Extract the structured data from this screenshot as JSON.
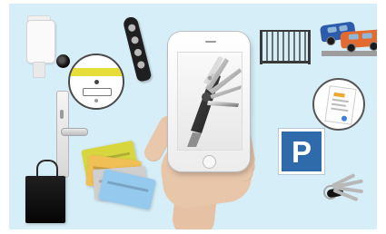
{
  "scene": {
    "parking_sign": {
      "label": "P"
    }
  }
}
